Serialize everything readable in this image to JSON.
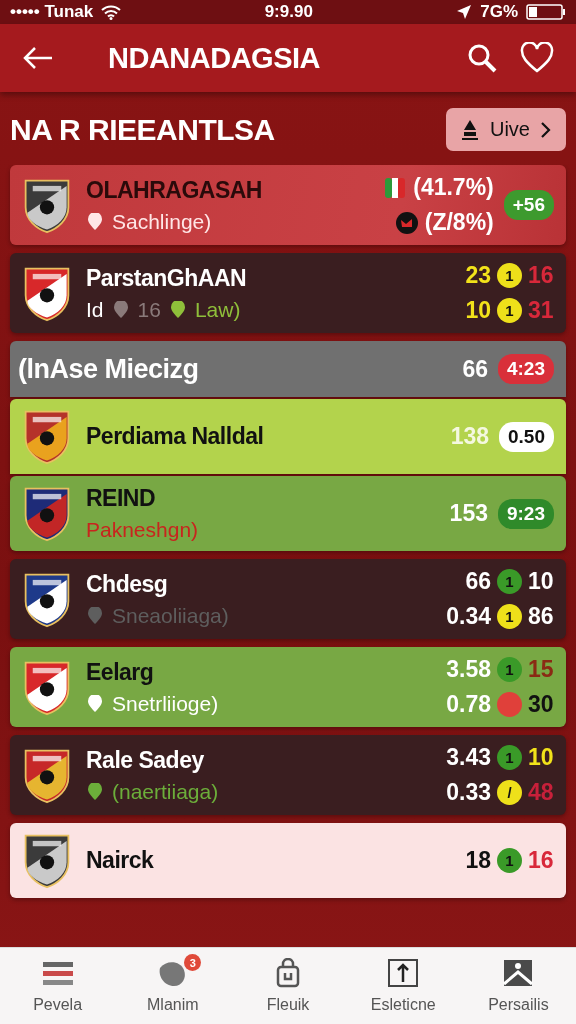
{
  "status_bar": {
    "carrier": "••••• Tunak",
    "time": "9:9.90",
    "battery": "7G%"
  },
  "header": {
    "title": "NDANADAGSIA"
  },
  "section": {
    "title": "NA R RIEEANTLSA",
    "button": "Uive"
  },
  "rows": [
    {
      "kind": "red",
      "name": "OLAHRAGASAH",
      "sub": [
        {
          "text": "Sachlinge)",
          "color": "#ffe6e6",
          "icon": true
        }
      ],
      "lines": [
        {
          "value": "(41.7%)",
          "color": "#ffffff",
          "flag": true
        },
        {
          "value": "(Z/8%)",
          "color": "#ffffff",
          "flag": true
        }
      ],
      "pill": {
        "label": "+56",
        "color": "#3d9a2e"
      }
    },
    {
      "kind": "dark",
      "name": "ParstanGhAAN",
      "sub": [
        {
          "text": "Id",
          "color": "#ffffff",
          "icon": false
        },
        {
          "text": "16",
          "color": "#8a7a7a",
          "icon": true
        },
        {
          "text": "Law)",
          "color": "#8fbf3a",
          "icon": true
        }
      ],
      "lines": [
        {
          "value": "23",
          "color": "#f2e21a",
          "dot": {
            "label": "1",
            "color": "#eee01a"
          },
          "extra": {
            "text": "16",
            "color": "#d8283a"
          }
        },
        {
          "value": "10",
          "color": "#f2e21a",
          "dot": {
            "label": "1",
            "color": "#eee01a"
          },
          "extra": {
            "text": "31",
            "color": "#d8283a"
          }
        }
      ]
    },
    {
      "kind": "grey",
      "name": "(lnAse Miecizg",
      "lines": [
        {
          "value": "66",
          "color": "#ffffff"
        }
      ],
      "pill": {
        "label": "4:23",
        "color": "#d9303a"
      }
    },
    {
      "kind": "lime",
      "name": "Perdiama Nalldal",
      "lines": [
        {
          "value": "138",
          "color": "#f4f8e0"
        }
      ],
      "pill": {
        "label": "0.50",
        "color": "#ffffff"
      }
    },
    {
      "kind": "olive",
      "name": "REIND",
      "sub": [
        {
          "text": "Pakneshgn)",
          "color": "#c8251e",
          "icon": false
        }
      ],
      "lines": [
        {
          "value": "153",
          "color": "#ffffff"
        }
      ],
      "pill": {
        "label": "9:23",
        "color": "#2f8a2a"
      }
    },
    {
      "kind": "dark",
      "name": "Chdesg",
      "sub": [
        {
          "text": "Sneaoliiaga)",
          "color": "#5e5e5e",
          "icon": true
        }
      ],
      "lines": [
        {
          "value": "66",
          "color": "#ffffff",
          "dot": {
            "label": "1",
            "color": "#3a9a28"
          },
          "extra": {
            "text": "10",
            "color": "#ffffff"
          }
        },
        {
          "value": "0.34",
          "color": "#ffffff",
          "dot": {
            "label": "1",
            "color": "#eee01a"
          },
          "extra": {
            "text": "86",
            "color": "#ffffff"
          }
        }
      ]
    },
    {
      "kind": "olive",
      "name": "Eelarg",
      "sub": [
        {
          "text": "Snetrliioge)",
          "color": "#ffffff",
          "icon": true
        }
      ],
      "lines": [
        {
          "value": "3.58",
          "color": "#ffffff",
          "dot": {
            "label": "1",
            "color": "#3a9a28"
          },
          "extra": {
            "text": "15",
            "color": "#8a2a14"
          }
        },
        {
          "value": "0.78",
          "color": "#ffffff",
          "dot": {
            "color": "#e0403a"
          },
          "extra": {
            "text": "30",
            "color": "#111111"
          }
        }
      ]
    },
    {
      "kind": "dark",
      "name": "Rale Sadey",
      "sub": [
        {
          "text": "(naertiiaga)",
          "color": "#6cae3a",
          "icon": true
        }
      ],
      "lines": [
        {
          "value": "3.43",
          "color": "#ffffff",
          "dot": {
            "label": "1",
            "color": "#3a9a28"
          },
          "extra": {
            "text": "10",
            "color": "#f2e21a"
          }
        },
        {
          "value": "0.33",
          "color": "#ffffff",
          "dot": {
            "label": "/",
            "color": "#eee01a"
          },
          "extra": {
            "text": "48",
            "color": "#c8203a"
          }
        }
      ]
    },
    {
      "kind": "light",
      "name": "Nairck",
      "lines": [
        {
          "value": "18",
          "color": "#111111",
          "dot": {
            "label": "1",
            "color": "#3a9a28"
          },
          "extra": {
            "text": "16",
            "color": "#d8283a"
          }
        }
      ]
    }
  ],
  "tabs": [
    {
      "label": "Pevela"
    },
    {
      "label": "Mlanim",
      "badge": "3"
    },
    {
      "label": "Fleuik"
    },
    {
      "label": "Esleticne"
    },
    {
      "label": "Persailis"
    }
  ]
}
